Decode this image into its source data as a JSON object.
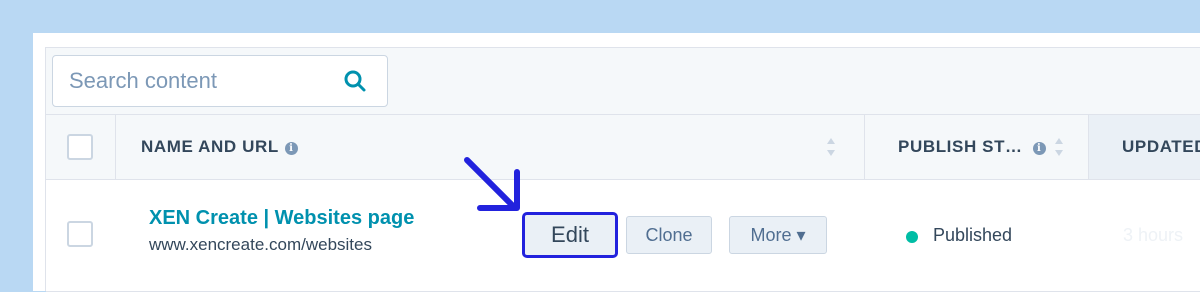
{
  "search": {
    "placeholder": "Search content"
  },
  "table": {
    "columns": {
      "name_url": "NAME AND URL",
      "publish_status": "PUBLISH ST…",
      "updated": "UPDATED"
    },
    "info_glyph": "i",
    "rows": [
      {
        "title": "XEN Create | Websites page",
        "url": "www.xencreate.com/websites",
        "actions": {
          "edit": "Edit",
          "clone": "Clone",
          "more": "More ▾"
        },
        "status": "Published",
        "status_color": "#00bda5",
        "updated": "3 hours"
      }
    ]
  },
  "annotation": {
    "highlight_color": "#2222dd",
    "arrow_color": "#2222dd"
  }
}
